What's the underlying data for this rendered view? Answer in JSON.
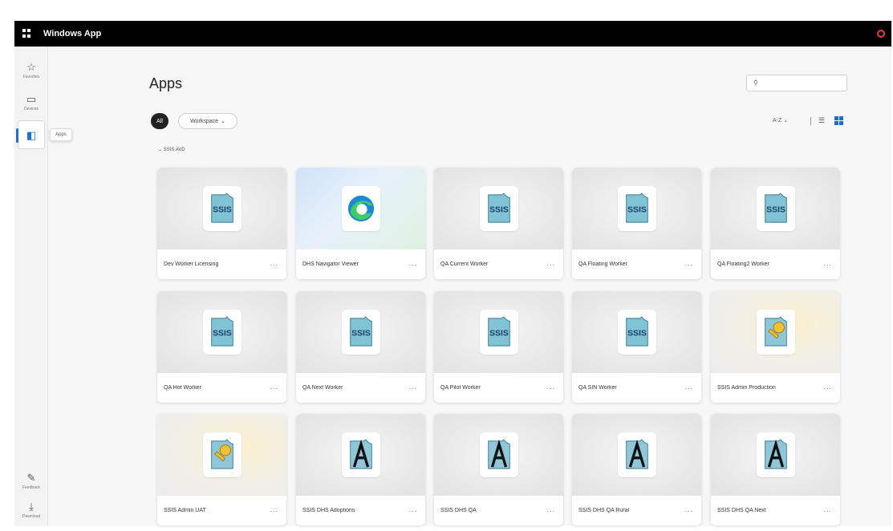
{
  "window": {
    "title": "Windows App"
  },
  "sidebar": {
    "items": [
      {
        "label": "Favorites",
        "icon": "star-icon"
      },
      {
        "label": "Devices",
        "icon": "monitor-icon"
      },
      {
        "label": "Apps",
        "icon": "apps-icon",
        "active": true
      },
      {
        "label": "Feedback",
        "icon": "feedback-icon"
      },
      {
        "label": "Download",
        "icon": "download-icon"
      }
    ],
    "tooltip": "Apps"
  },
  "page": {
    "title": "Apps"
  },
  "search": {
    "placeholder": "",
    "value": ""
  },
  "filters": {
    "all_label": "All",
    "workspace_label": "Workspace"
  },
  "view": {
    "sort_label": "A-Z"
  },
  "group": {
    "label": "SSIS AVD"
  },
  "apps": [
    {
      "label": "Dev Worker Licensing",
      "icon": "ssis-icon"
    },
    {
      "label": "DHS Navigator Viewer",
      "icon": "edge-icon"
    },
    {
      "label": "QA Current Worker",
      "icon": "ssis-icon"
    },
    {
      "label": "QA Floating Worker",
      "icon": "ssis-icon"
    },
    {
      "label": "QA Floating2 Worker",
      "icon": "ssis-icon"
    },
    {
      "label": "QA Hot Worker",
      "icon": "ssis-icon"
    },
    {
      "label": "QA Next Worker",
      "icon": "ssis-icon"
    },
    {
      "label": "QA Pilot Worker",
      "icon": "ssis-icon"
    },
    {
      "label": "QA SIN Worker",
      "icon": "ssis-icon"
    },
    {
      "label": "SSIS Admin Production",
      "icon": "key-icon"
    },
    {
      "label": "SSIS Admin UAT",
      "icon": "key-icon"
    },
    {
      "label": "SSIS DHS Adoptions",
      "icon": "a-icon"
    },
    {
      "label": "SSIS DHS QA",
      "icon": "a-icon"
    },
    {
      "label": "SSIS DHS QA Rural",
      "icon": "a-icon"
    },
    {
      "label": "SSIS DHS QA Next",
      "icon": "a-icon"
    }
  ],
  "card_more": "...",
  "colors": {
    "accent": "#1a6fd0",
    "titlebar": "#000000"
  }
}
